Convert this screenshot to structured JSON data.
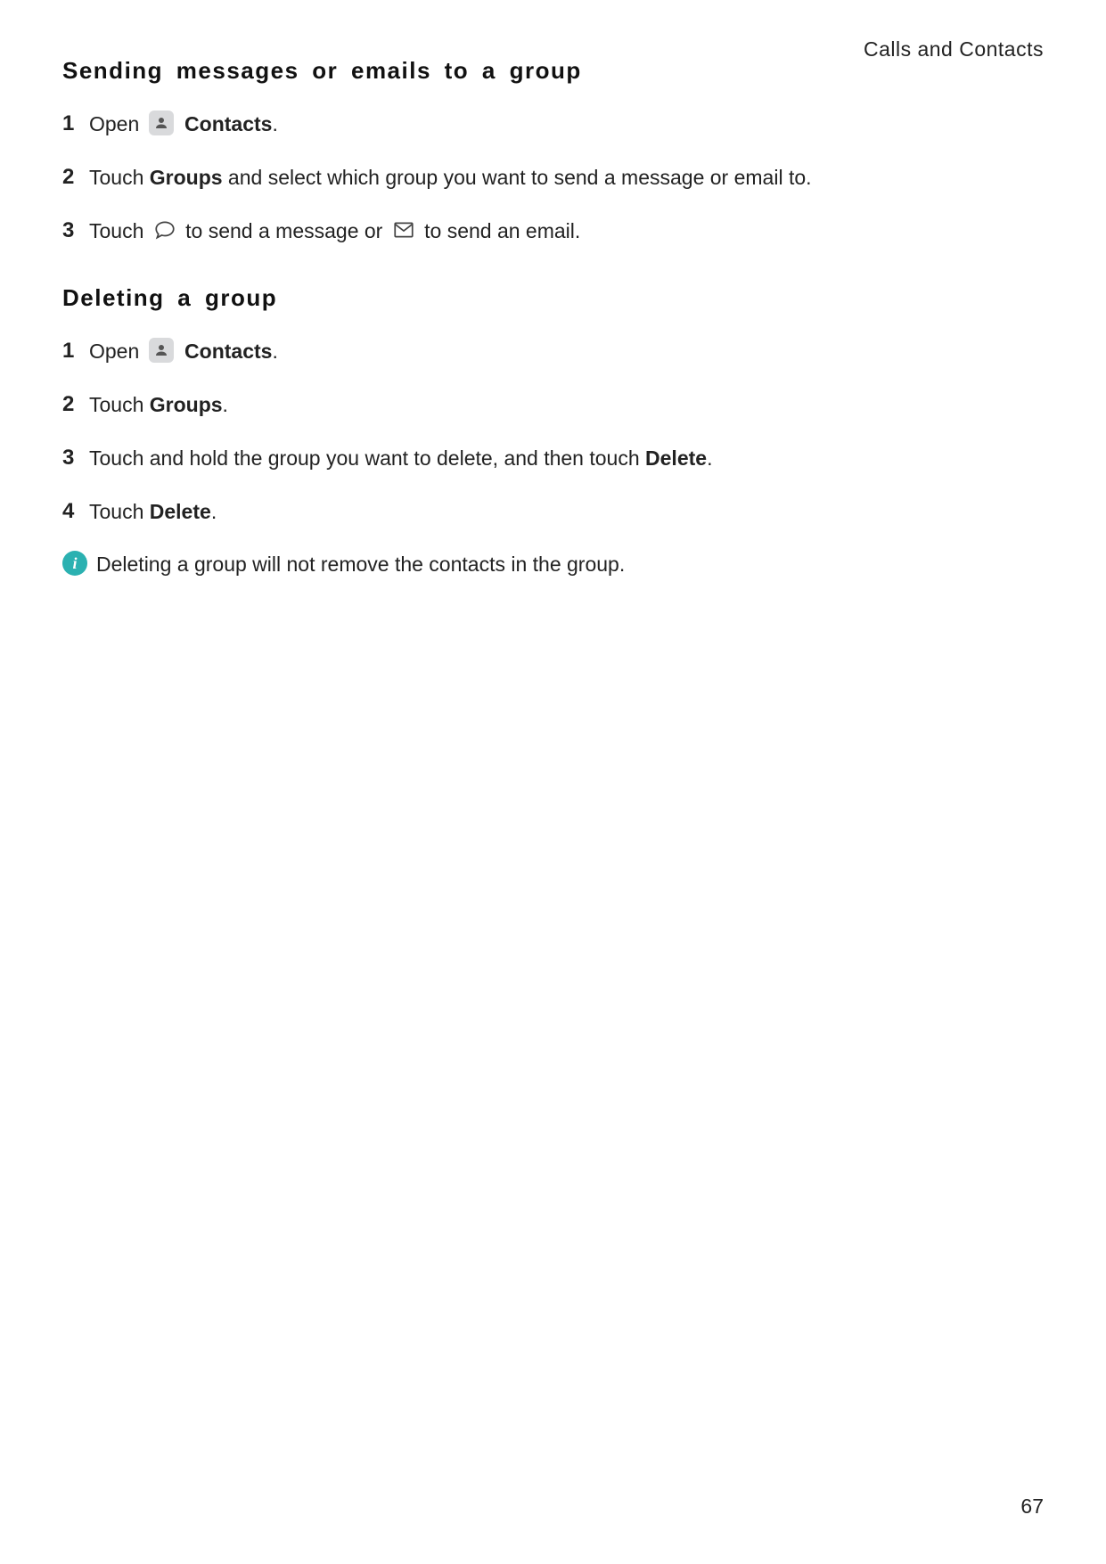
{
  "header": {
    "running": "Calls and Contacts"
  },
  "section1": {
    "heading": "Sending messages or emails to a group",
    "steps": [
      {
        "num": "1",
        "parts": {
          "p0": "Open ",
          "contacts_label": "Contacts",
          "p1": "."
        }
      },
      {
        "num": "2",
        "parts": {
          "p0": "Touch ",
          "groups_label": "Groups",
          "p1": " and select which group you want to send a message or email to."
        }
      },
      {
        "num": "3",
        "parts": {
          "p0": "Touch ",
          "p1": " to send a message or ",
          "p2": " to send an email."
        }
      }
    ]
  },
  "section2": {
    "heading": "Deleting a group",
    "steps": [
      {
        "num": "1",
        "parts": {
          "p0": "Open ",
          "contacts_label": "Contacts",
          "p1": "."
        }
      },
      {
        "num": "2",
        "parts": {
          "p0": "Touch ",
          "groups_label": "Groups",
          "p1": "."
        }
      },
      {
        "num": "3",
        "parts": {
          "p0": "Touch and hold the group you want to delete, and then touch ",
          "delete_label": "Delete",
          "p1": "."
        }
      },
      {
        "num": "4",
        "parts": {
          "p0": "Touch ",
          "delete_label": "Delete",
          "p1": "."
        }
      }
    ]
  },
  "info_note": {
    "badge": "i",
    "text": "Deleting a group will not remove the contacts in the group."
  },
  "page_number": "67"
}
